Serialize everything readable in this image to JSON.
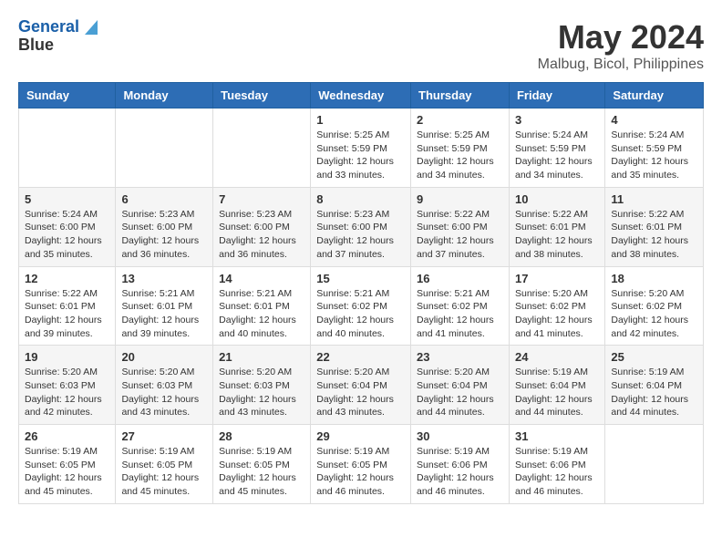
{
  "logo": {
    "line1": "General",
    "line2": "Blue"
  },
  "title": "May 2024",
  "location": "Malbug, Bicol, Philippines",
  "weekdays": [
    "Sunday",
    "Monday",
    "Tuesday",
    "Wednesday",
    "Thursday",
    "Friday",
    "Saturday"
  ],
  "weeks": [
    [
      {
        "day": "",
        "info": ""
      },
      {
        "day": "",
        "info": ""
      },
      {
        "day": "",
        "info": ""
      },
      {
        "day": "1",
        "sunrise": "5:25 AM",
        "sunset": "5:59 PM",
        "daylight": "12 hours and 33 minutes."
      },
      {
        "day": "2",
        "sunrise": "5:25 AM",
        "sunset": "5:59 PM",
        "daylight": "12 hours and 34 minutes."
      },
      {
        "day": "3",
        "sunrise": "5:24 AM",
        "sunset": "5:59 PM",
        "daylight": "12 hours and 34 minutes."
      },
      {
        "day": "4",
        "sunrise": "5:24 AM",
        "sunset": "5:59 PM",
        "daylight": "12 hours and 35 minutes."
      }
    ],
    [
      {
        "day": "5",
        "sunrise": "5:24 AM",
        "sunset": "6:00 PM",
        "daylight": "12 hours and 35 minutes."
      },
      {
        "day": "6",
        "sunrise": "5:23 AM",
        "sunset": "6:00 PM",
        "daylight": "12 hours and 36 minutes."
      },
      {
        "day": "7",
        "sunrise": "5:23 AM",
        "sunset": "6:00 PM",
        "daylight": "12 hours and 36 minutes."
      },
      {
        "day": "8",
        "sunrise": "5:23 AM",
        "sunset": "6:00 PM",
        "daylight": "12 hours and 37 minutes."
      },
      {
        "day": "9",
        "sunrise": "5:22 AM",
        "sunset": "6:00 PM",
        "daylight": "12 hours and 37 minutes."
      },
      {
        "day": "10",
        "sunrise": "5:22 AM",
        "sunset": "6:01 PM",
        "daylight": "12 hours and 38 minutes."
      },
      {
        "day": "11",
        "sunrise": "5:22 AM",
        "sunset": "6:01 PM",
        "daylight": "12 hours and 38 minutes."
      }
    ],
    [
      {
        "day": "12",
        "sunrise": "5:22 AM",
        "sunset": "6:01 PM",
        "daylight": "12 hours and 39 minutes."
      },
      {
        "day": "13",
        "sunrise": "5:21 AM",
        "sunset": "6:01 PM",
        "daylight": "12 hours and 39 minutes."
      },
      {
        "day": "14",
        "sunrise": "5:21 AM",
        "sunset": "6:01 PM",
        "daylight": "12 hours and 40 minutes."
      },
      {
        "day": "15",
        "sunrise": "5:21 AM",
        "sunset": "6:02 PM",
        "daylight": "12 hours and 40 minutes."
      },
      {
        "day": "16",
        "sunrise": "5:21 AM",
        "sunset": "6:02 PM",
        "daylight": "12 hours and 41 minutes."
      },
      {
        "day": "17",
        "sunrise": "5:20 AM",
        "sunset": "6:02 PM",
        "daylight": "12 hours and 41 minutes."
      },
      {
        "day": "18",
        "sunrise": "5:20 AM",
        "sunset": "6:02 PM",
        "daylight": "12 hours and 42 minutes."
      }
    ],
    [
      {
        "day": "19",
        "sunrise": "5:20 AM",
        "sunset": "6:03 PM",
        "daylight": "12 hours and 42 minutes."
      },
      {
        "day": "20",
        "sunrise": "5:20 AM",
        "sunset": "6:03 PM",
        "daylight": "12 hours and 43 minutes."
      },
      {
        "day": "21",
        "sunrise": "5:20 AM",
        "sunset": "6:03 PM",
        "daylight": "12 hours and 43 minutes."
      },
      {
        "day": "22",
        "sunrise": "5:20 AM",
        "sunset": "6:04 PM",
        "daylight": "12 hours and 43 minutes."
      },
      {
        "day": "23",
        "sunrise": "5:20 AM",
        "sunset": "6:04 PM",
        "daylight": "12 hours and 44 minutes."
      },
      {
        "day": "24",
        "sunrise": "5:19 AM",
        "sunset": "6:04 PM",
        "daylight": "12 hours and 44 minutes."
      },
      {
        "day": "25",
        "sunrise": "5:19 AM",
        "sunset": "6:04 PM",
        "daylight": "12 hours and 44 minutes."
      }
    ],
    [
      {
        "day": "26",
        "sunrise": "5:19 AM",
        "sunset": "6:05 PM",
        "daylight": "12 hours and 45 minutes."
      },
      {
        "day": "27",
        "sunrise": "5:19 AM",
        "sunset": "6:05 PM",
        "daylight": "12 hours and 45 minutes."
      },
      {
        "day": "28",
        "sunrise": "5:19 AM",
        "sunset": "6:05 PM",
        "daylight": "12 hours and 45 minutes."
      },
      {
        "day": "29",
        "sunrise": "5:19 AM",
        "sunset": "6:05 PM",
        "daylight": "12 hours and 46 minutes."
      },
      {
        "day": "30",
        "sunrise": "5:19 AM",
        "sunset": "6:06 PM",
        "daylight": "12 hours and 46 minutes."
      },
      {
        "day": "31",
        "sunrise": "5:19 AM",
        "sunset": "6:06 PM",
        "daylight": "12 hours and 46 minutes."
      },
      {
        "day": "",
        "info": ""
      }
    ]
  ]
}
